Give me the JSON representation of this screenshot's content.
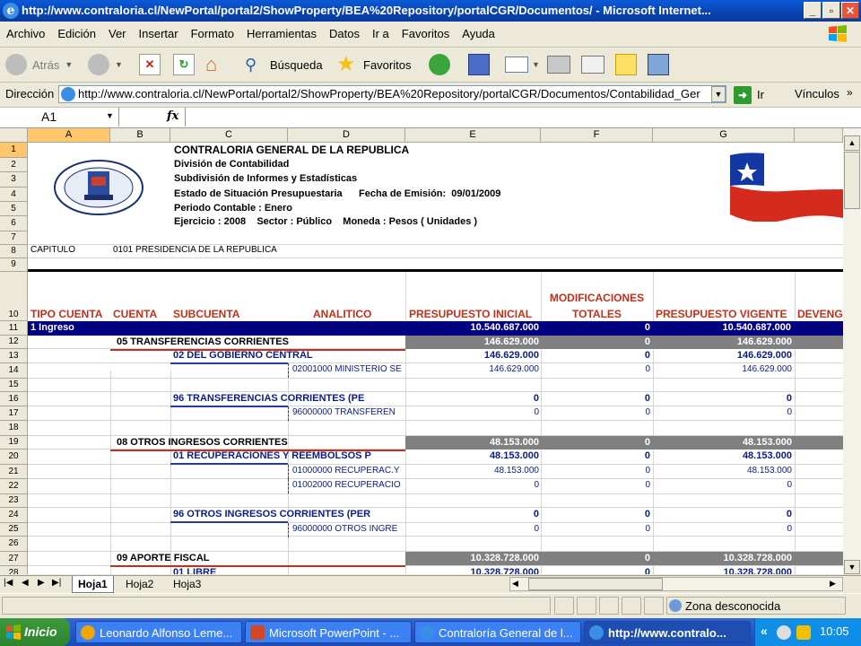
{
  "window": {
    "title": "http://www.contraloria.cl/NewPortal/portal2/ShowProperty/BEA%20Repository/portalCGR/Documentos/ - Microsoft Internet..."
  },
  "menu": [
    "Archivo",
    "Edición",
    "Ver",
    "Insertar",
    "Formato",
    "Herramientas",
    "Datos",
    "Ir a",
    "Favoritos",
    "Ayuda"
  ],
  "toolbar": {
    "back_label": "Atrás",
    "search_label": "Búsqueda",
    "favorites_label": "Favoritos"
  },
  "address": {
    "label": "Dirección",
    "url": "http://www.contraloria.cl/NewPortal/portal2/ShowProperty/BEA%20Repository/portalCGR/Documentos/Contabilidad_Ger",
    "go_label": "Ir",
    "links_label": "Vínculos"
  },
  "formula": {
    "cell_ref": "A1",
    "fx": "fx",
    "value": ""
  },
  "sheet": {
    "columns": [
      "A",
      "B",
      "C",
      "D",
      "E",
      "F",
      "G"
    ],
    "rows": [
      "1",
      "2",
      "3",
      "4",
      "5",
      "6",
      "7",
      "8",
      "9",
      "10",
      "11",
      "12",
      "13",
      "14",
      "15",
      "16",
      "17",
      "18",
      "19",
      "20",
      "21",
      "22",
      "23",
      "24",
      "25",
      "26",
      "27",
      "28"
    ],
    "header_lines": [
      "CONTRALORIA GENERAL DE LA REPUBLICA",
      "División de Contabilidad",
      "Subdivisión de Informes y Estadísticas",
      "Estado de Situación Presupuestaria      Fecha de Emisión:  09/01/2009",
      "Periodo Contable : Enero",
      "Ejercicio : 2008    Sector : Público    Moneda : Pesos ( Unidades )"
    ],
    "capitulo_label": "CAPITULO",
    "capitulo_value": "0101 PRESIDENCIA DE LA REPUBLICA",
    "col_titles": {
      "tipo": "TIPO CUENTA",
      "cuenta": "CUENTA",
      "subcuenta": "SUBCUENTA",
      "analitico": "ANALITICO",
      "presupuesto_inicial": "PRESUPUESTO INICIAL",
      "modificaciones_1": "MODIFICACIONES",
      "modificaciones_2": "TOTALES",
      "presupuesto_vigente": "PRESUPUESTO VIGENTE",
      "devengado": "DEVENG"
    },
    "ingreso_label": "1 Ingreso",
    "ingreso_values": [
      "10.540.687.000",
      "0",
      "10.540.687.000"
    ],
    "lines": {
      "r12": {
        "label": "05 TRANSFERENCIAS CORRIENTES",
        "e": "146.629.000",
        "f": "0",
        "g": "146.629.000"
      },
      "r13": {
        "label": "02 DEL GOBIERNO CENTRAL",
        "e": "146.629.000",
        "f": "0",
        "g": "146.629.000"
      },
      "r14": {
        "label": "02001000 MINISTERIO SE",
        "e": "146.629.000",
        "f": "0",
        "g": "146.629.000"
      },
      "r16": {
        "label": "96 TRANSFERENCIAS CORRIENTES (PE",
        "e": "0",
        "f": "0",
        "g": "0"
      },
      "r17": {
        "label": "96000000 TRANSFEREN",
        "e": "0",
        "f": "0",
        "g": "0"
      },
      "r19": {
        "label": "08 OTROS INGRESOS CORRIENTES",
        "e": "48.153.000",
        "f": "0",
        "g": "48.153.000"
      },
      "r20": {
        "label": "01 RECUPERACIONES Y REEMBOLSOS P",
        "e": "48.153.000",
        "f": "0",
        "g": "48.153.000"
      },
      "r21": {
        "label": "01000000 RECUPERAC.Y",
        "e": "48.153.000",
        "f": "0",
        "g": "48.153.000"
      },
      "r22": {
        "label": "01002000 RECUPERACIO",
        "e": "0",
        "f": "0",
        "g": "0"
      },
      "r24": {
        "label": "96 OTROS INGRESOS CORRIENTES (PER",
        "e": "0",
        "f": "0",
        "g": "0"
      },
      "r25": {
        "label": "96000000 OTROS INGRE",
        "e": "0",
        "f": "0",
        "g": "0"
      },
      "r27": {
        "label": "09 APORTE FISCAL",
        "e": "10.328.728.000",
        "f": "0",
        "g": "10.328.728.000"
      },
      "r28": {
        "label": "01 LIBRE",
        "e": "10.328.728.000",
        "f": "0",
        "g": "10.328.728.000"
      }
    }
  },
  "tabs": [
    "Hoja1",
    "Hoja2",
    "Hoja3"
  ],
  "status": {
    "zone": "Zona desconocida"
  },
  "taskbar": {
    "start": "Inicio",
    "tasks": [
      "Leonardo Alfonso Leme...",
      "Microsoft PowerPoint - ...",
      "Contraloría General de l...",
      "http://www.contralo..."
    ],
    "clock": "10:05",
    "chevron": "«"
  },
  "colors": {
    "navy": "#0a1e80",
    "ingreso_row": "#000080",
    "gray_fill": "#808080",
    "header_red": "#c0301a"
  }
}
